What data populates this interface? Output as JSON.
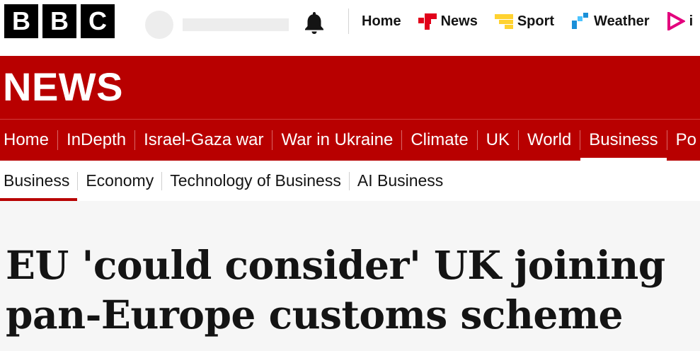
{
  "masthead": {
    "logo_letters": [
      "B",
      "B",
      "C"
    ],
    "nav": [
      {
        "label": "Home",
        "icon": "none"
      },
      {
        "label": "News",
        "icon": "news-icon",
        "color": "#e1001a"
      },
      {
        "label": "Sport",
        "icon": "sport-icon",
        "color": "#ffd230"
      },
      {
        "label": "Weather",
        "icon": "weather-icon",
        "color": "#1a8fd8"
      },
      {
        "label": "i",
        "icon": "iplayer-icon",
        "color": "#e3007d"
      }
    ]
  },
  "news_header": {
    "title": "NEWS",
    "background": "#b80000",
    "sections": [
      "Home",
      "InDepth",
      "Israel-Gaza war",
      "War in Ukraine",
      "Climate",
      "UK",
      "World",
      "Business",
      "Po"
    ],
    "active_section": "Business"
  },
  "sub_nav": {
    "items": [
      "Business",
      "Economy",
      "Technology of Business",
      "AI Business"
    ],
    "active_item": "Business"
  },
  "article": {
    "headline": "EU 'could consider' UK joining pan-Europe customs scheme"
  }
}
